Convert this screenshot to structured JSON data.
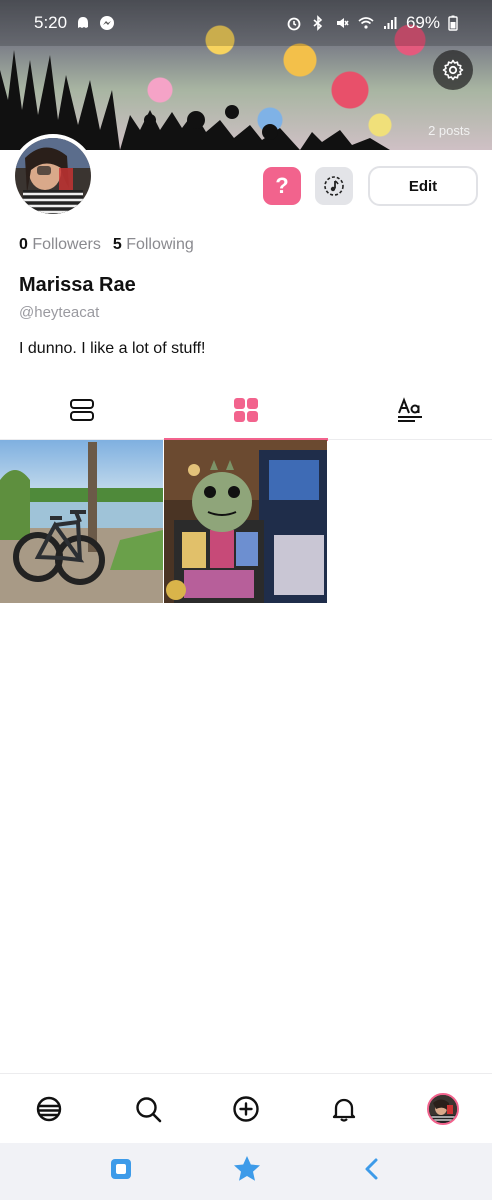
{
  "status_bar": {
    "time": "5:20",
    "battery": "69%",
    "left_icons": [
      "ghost-icon",
      "messenger-icon"
    ],
    "right_icons": [
      "alarm-icon",
      "bluetooth-icon",
      "mute-icon",
      "wifi-icon",
      "signal-icon",
      "battery-icon"
    ]
  },
  "header": {
    "posts_count": "2 posts",
    "settings_icon": "gear-icon"
  },
  "profile": {
    "followers_count": "0",
    "followers_label": "Followers",
    "following_count": "5",
    "following_label": "Following",
    "display_name": "Marissa Rae",
    "handle": "@heyteacat",
    "bio": "I dunno. I like a lot of stuff!",
    "question_button": "?",
    "edit_button": "Edit"
  },
  "tabs": [
    {
      "name": "list-view",
      "icon": "list-icon",
      "active": false
    },
    {
      "name": "grid-view",
      "icon": "grid-icon",
      "active": true
    },
    {
      "name": "text-view",
      "icon": "text-icon",
      "active": false
    }
  ],
  "grid_posts": [
    {
      "subject": "bicycle by river"
    },
    {
      "subject": "crochet plush and trading cards"
    }
  ],
  "bottom_nav": [
    "home-icon",
    "search-icon",
    "create-icon",
    "bell-icon",
    "profile-avatar"
  ],
  "system_nav": [
    "recent-apps-icon",
    "favorite-star-icon",
    "back-icon"
  ],
  "colors": {
    "accent": "#f2638d",
    "muted_text": "#8a8a8f",
    "system_nav_blue": "#3d9be9"
  }
}
